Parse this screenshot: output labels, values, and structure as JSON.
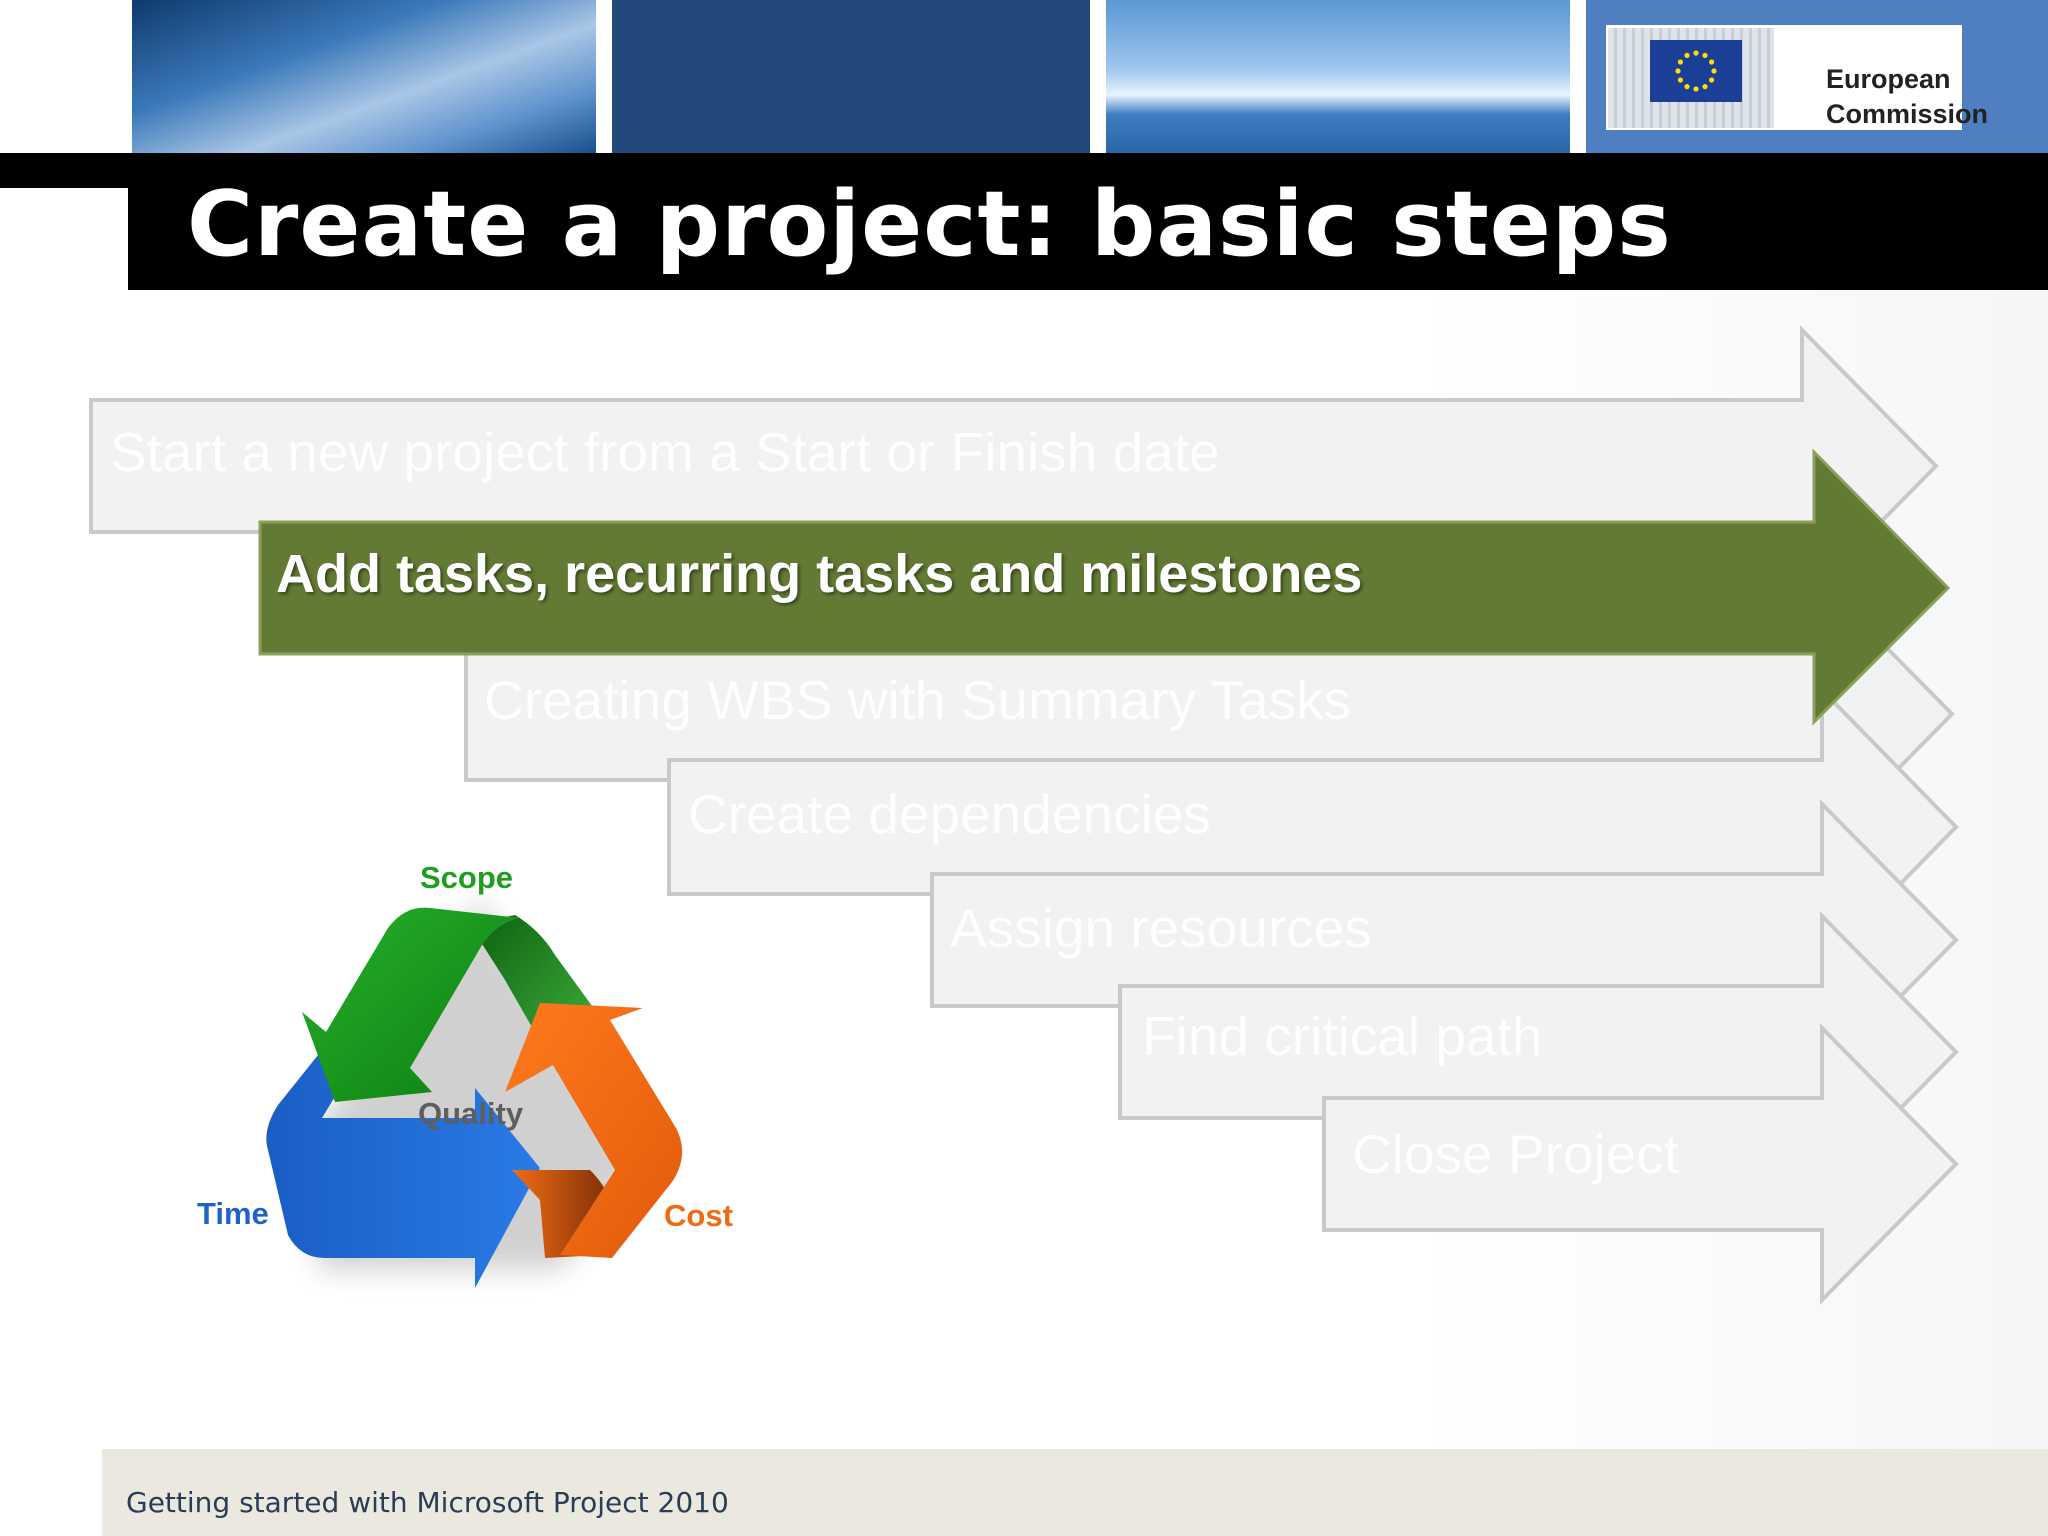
{
  "header": {
    "organization_line1": "European",
    "organization_line2": "Commission"
  },
  "title": "Create a project: basic steps",
  "steps": [
    {
      "label": "Start a new project from a Start or Finish date",
      "active": false
    },
    {
      "label": "Add tasks, recurring tasks and milestones",
      "active": true
    },
    {
      "label": "Creating WBS with Summary Tasks",
      "active": false
    },
    {
      "label": "Create dependencies",
      "active": false
    },
    {
      "label": "Assign resources",
      "active": false
    },
    {
      "label": "Find critical path",
      "active": false
    },
    {
      "label": "Close Project",
      "active": false
    }
  ],
  "triangle": {
    "scope": "Scope",
    "quality": "Quality",
    "time": "Time",
    "cost": "Cost"
  },
  "footer": "Getting started with Microsoft Project 2010",
  "colors": {
    "active_step": "#627a33",
    "inactive_step": "#f2f2f3",
    "step_outline": "#c9c9cc",
    "scope": "#1f9e1f",
    "cost": "#ef6a14",
    "time": "#1e64c8",
    "quality": "#5e5e5e",
    "banner_blue": "#22497b",
    "footer_bg": "#ebe9df"
  }
}
